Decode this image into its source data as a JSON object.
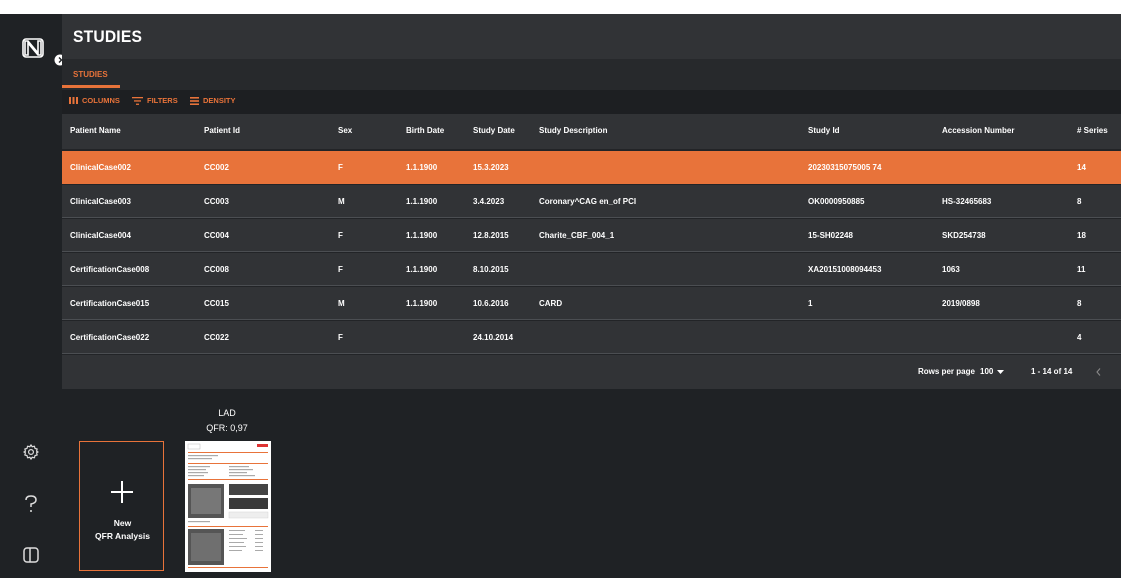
{
  "app": {
    "title": "STUDIES",
    "tab": "STUDIES"
  },
  "toolbar": {
    "columns": "COLUMNS",
    "filters": "FILTERS",
    "density": "DENSITY"
  },
  "columns": [
    "Patient Name",
    "Patient Id",
    "Sex",
    "Birth Date",
    "Study Date",
    "Study Description",
    "Study Id",
    "Accession Number",
    "# Series"
  ],
  "rows": [
    [
      "ClinicalCase002",
      "CC002",
      "F",
      "1.1.1900",
      "15.3.2023",
      "",
      "20230315075005 74",
      "",
      "14"
    ],
    [
      "ClinicalCase003",
      "CC003",
      "M",
      "1.1.1900",
      "3.4.2023",
      "Coronary^CAG en_of PCI",
      "OK0000950885",
      "HS-32465683",
      "8"
    ],
    [
      "ClinicalCase004",
      "CC004",
      "F",
      "1.1.1900",
      "12.8.2015",
      "Charite_CBF_004_1",
      "15-SH02248",
      "SKD254738",
      "18"
    ],
    [
      "CertificationCase008",
      "CC008",
      "F",
      "1.1.1900",
      "8.10.2015",
      "",
      "XA20151008094453",
      "1063",
      "11"
    ],
    [
      "CertificationCase015",
      "CC015",
      "M",
      "1.1.1900",
      "10.6.2016",
      "CARD",
      "1",
      "2019/0898",
      "8"
    ],
    [
      "CertificationCase022",
      "CC022",
      "F",
      "",
      "24.10.2014",
      "",
      "",
      "",
      "4"
    ]
  ],
  "selected_row": 0,
  "footer": {
    "rows_per_page_label": "Rows per page",
    "rows_per_page": "100",
    "range": "1 - 14 of 14"
  },
  "analysis": {
    "new_line1": "New",
    "new_line2": "QFR Analysis",
    "thumb_line1": "LAD",
    "thumb_line2": "QFR: 0,97"
  },
  "icons": [
    "app-logo-icon",
    "expand-chevron-icon",
    "columns-icon",
    "filter-icon",
    "density-icon",
    "dropdown-arrow-icon",
    "prev-page-icon",
    "settings-gear-icon",
    "help-icon",
    "document-icon",
    "plus-icon"
  ],
  "colors": {
    "accent": "#e8733a",
    "panel": "#313336",
    "sidebar": "#1f2225"
  }
}
